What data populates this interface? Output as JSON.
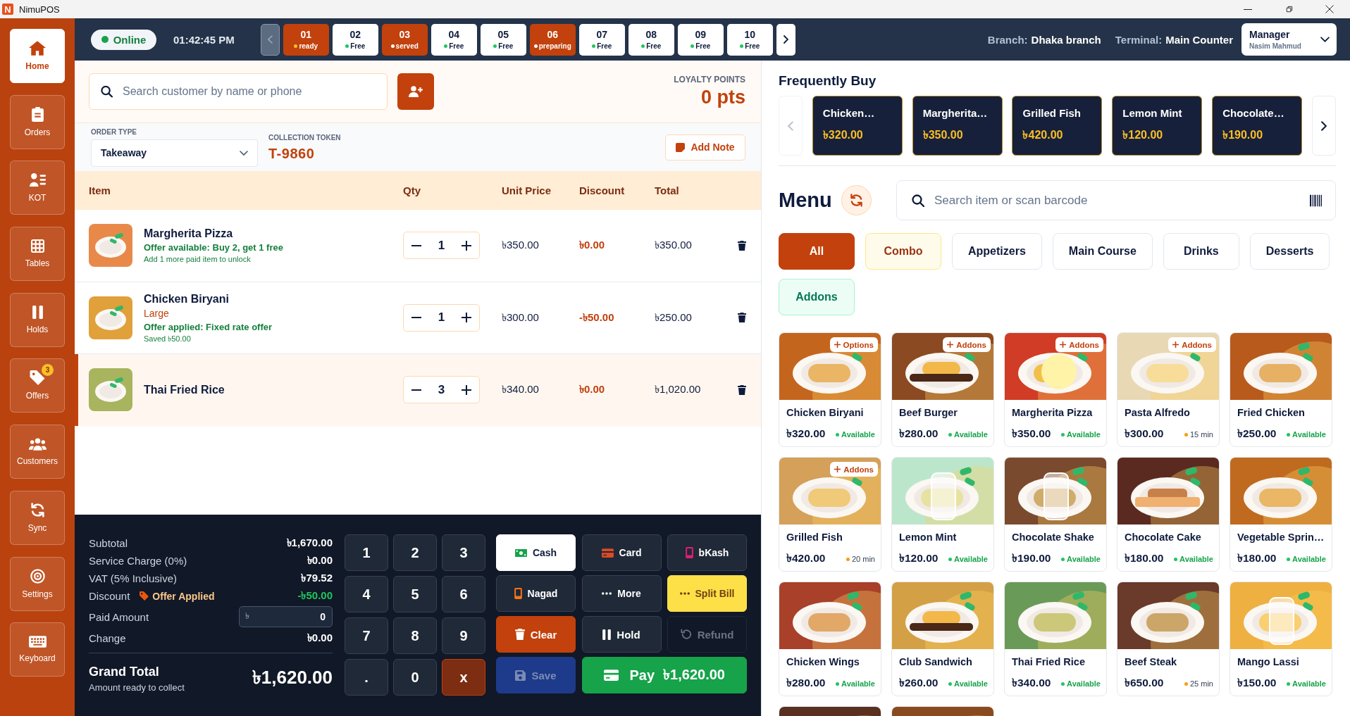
{
  "window": {
    "logo": "N",
    "title": "NimuPOS"
  },
  "sidebar": [
    {
      "label": "Home",
      "selected": true
    },
    {
      "label": "Orders",
      "selected": false
    },
    {
      "label": "KOT",
      "selected": false
    },
    {
      "label": "Tables",
      "selected": false
    },
    {
      "label": "Holds",
      "selected": false
    },
    {
      "label": "Offers",
      "selected": false,
      "badge": "3"
    },
    {
      "label": "Customers",
      "selected": false
    },
    {
      "label": "Sync",
      "selected": false
    },
    {
      "label": "Settings",
      "selected": false
    },
    {
      "label": "Keyboard",
      "selected": false
    }
  ],
  "topbar": {
    "status": "Online",
    "time": "01:42:45 PM",
    "tables_prev": {
      "disabled": true
    },
    "tables": [
      {
        "number": "01",
        "status": "ready",
        "kind": "ready"
      },
      {
        "number": "02",
        "status": "Free",
        "kind": "free"
      },
      {
        "number": "03",
        "status": "served",
        "kind": "served"
      },
      {
        "number": "04",
        "status": "Free",
        "kind": "free"
      },
      {
        "number": "05",
        "status": "Free",
        "kind": "free"
      },
      {
        "number": "06",
        "status": "preparing",
        "kind": "preparing"
      },
      {
        "number": "07",
        "status": "Free",
        "kind": "free"
      },
      {
        "number": "08",
        "status": "Free",
        "kind": "free"
      },
      {
        "number": "09",
        "status": "Free",
        "kind": "free"
      },
      {
        "number": "10",
        "status": "Free",
        "kind": "free"
      }
    ],
    "tables_next": {
      "disabled": false
    },
    "branch": {
      "label": "Branch:",
      "value": "Dhaka branch"
    },
    "terminal": {
      "label": "Terminal:",
      "value": "Main Counter"
    },
    "user": {
      "role": "Manager",
      "name": "Nasim Mahmud"
    }
  },
  "order": {
    "customer_search": {
      "placeholder": "Search customer by name or phone"
    },
    "loyalty": {
      "label": "LOYALTY POINTS",
      "value": "0 pts"
    },
    "order_type": {
      "label": "ORDER TYPE",
      "value": "Takeaway"
    },
    "token": {
      "label": "COLLECTION TOKEN",
      "value": "T-9860"
    },
    "add_note": "Add Note",
    "columns": [
      "Item",
      "Qty",
      "Unit Price",
      "Discount",
      "Total"
    ],
    "items": [
      {
        "name": "Margherita Pizza",
        "notes": [
          {
            "kind": "offer",
            "text": "Offer available: Buy 2, get 1 free"
          },
          {
            "kind": "hint",
            "text": "Add 1 more paid item to unlock"
          }
        ],
        "qty": "1",
        "unit_price": "৳350.00",
        "discount": "৳0.00",
        "total": "৳350.00",
        "selected": false,
        "color": "#e8894a"
      },
      {
        "name": "Chicken Biryani",
        "notes": [
          {
            "kind": "variant",
            "text": "Large"
          },
          {
            "kind": "offer",
            "text": "Offer applied: Fixed rate offer"
          },
          {
            "kind": "hint",
            "text": "Saved ৳50.00"
          }
        ],
        "qty": "1",
        "unit_price": "৳300.00",
        "discount": "-৳50.00",
        "total": "৳250.00",
        "selected": false,
        "color": "#e0a03a"
      },
      {
        "name": "Thai Fried Rice",
        "qty": "3",
        "unit_price": "৳340.00",
        "discount": "৳0.00",
        "total": "৳1,020.00",
        "selected": true,
        "color": "#a8b45e"
      }
    ]
  },
  "summary": {
    "lines": [
      {
        "kind": "plain",
        "label": "Subtotal",
        "value": "৳1,670.00"
      },
      {
        "kind": "plain",
        "label": "Service Charge (0%)",
        "value": "৳0.00"
      },
      {
        "kind": "plain",
        "label": "VAT (5% Inclusive)",
        "value": "৳79.52"
      },
      {
        "kind": "discount",
        "label": "Discount",
        "tag": "Offer Applied",
        "value": "-৳50.00"
      },
      {
        "kind": "input",
        "label": "Paid Amount",
        "prefix": "৳",
        "value": "0"
      },
      {
        "kind": "plain",
        "label": "Change",
        "value": "৳0.00"
      }
    ],
    "grand_total": {
      "label": "Grand Total",
      "note": "Amount ready to collect",
      "value": "৳1,620.00"
    }
  },
  "keypad": [
    {
      "label": "1",
      "kind": "digit"
    },
    {
      "label": "2",
      "kind": "digit"
    },
    {
      "label": "3",
      "kind": "digit"
    },
    {
      "label": "4",
      "kind": "digit"
    },
    {
      "label": "5",
      "kind": "digit"
    },
    {
      "label": "6",
      "kind": "digit"
    },
    {
      "label": "7",
      "kind": "digit"
    },
    {
      "label": "8",
      "kind": "digit"
    },
    {
      "label": "9",
      "kind": "digit"
    },
    {
      "label": ".",
      "kind": "digit"
    },
    {
      "label": "0",
      "kind": "digit"
    },
    {
      "label": "x",
      "kind": "delete"
    }
  ],
  "actions": [
    {
      "label": "Cash",
      "kind": "cash",
      "color": "#16a34a",
      "selected": true,
      "disabled": false
    },
    {
      "label": "Card",
      "kind": "card",
      "color": "#dc4a26",
      "selected": false,
      "disabled": false
    },
    {
      "label": "bKash",
      "kind": "mobile",
      "color": "#e11d74",
      "selected": false,
      "disabled": false
    },
    {
      "label": "Nagad",
      "kind": "mobile",
      "color": "#f97316",
      "selected": false,
      "disabled": false
    },
    {
      "label": "More",
      "kind": "more",
      "selected": false,
      "disabled": false
    },
    {
      "label": "Split Bill",
      "kind": "split",
      "selected": false,
      "disabled": false
    },
    {
      "label": "Clear",
      "kind": "clear",
      "selected": false,
      "disabled": false
    },
    {
      "label": "Hold",
      "kind": "hold",
      "selected": false,
      "disabled": false
    },
    {
      "label": "Refund",
      "kind": "refund",
      "selected": false,
      "disabled": true
    },
    {
      "label": "Save",
      "kind": "save",
      "selected": false,
      "disabled": true
    },
    {
      "label": "Pay",
      "amount": "৳1,620.00",
      "kind": "pay",
      "selected": false,
      "disabled": false
    }
  ],
  "frequently_buy": {
    "title": "Frequently Buy",
    "prev": {
      "disabled": true
    },
    "items": [
      {
        "name": "Chicken…",
        "price": "৳320.00"
      },
      {
        "name": "Margherita…",
        "price": "৳350.00"
      },
      {
        "name": "Grilled Fish",
        "price": "৳420.00"
      },
      {
        "name": "Lemon Mint",
        "price": "৳120.00"
      },
      {
        "name": "Chocolate…",
        "price": "৳190.00"
      }
    ],
    "next": {
      "disabled": false
    }
  },
  "menu": {
    "title": "Menu",
    "search": {
      "placeholder": "Search item or scan barcode"
    },
    "categories": [
      {
        "label": "All",
        "kind": "plain",
        "selected": true
      },
      {
        "label": "Combo",
        "kind": "combo",
        "selected": false
      },
      {
        "label": "Appetizers",
        "kind": "plain",
        "selected": false
      },
      {
        "label": "Main Course",
        "kind": "plain",
        "selected": false
      },
      {
        "label": "Drinks",
        "kind": "plain",
        "selected": false
      },
      {
        "label": "Desserts",
        "kind": "plain",
        "selected": false
      },
      {
        "label": "Addons",
        "kind": "addon",
        "selected": false
      }
    ],
    "products": [
      {
        "name": "Chicken Biryani",
        "price": "৳320.00",
        "status": {
          "kind": "available",
          "text": "Available"
        },
        "badge": "Options",
        "kind": "plate",
        "color": "#c4651e"
      },
      {
        "name": "Beef Burger",
        "price": "৳280.00",
        "status": {
          "kind": "available",
          "text": "Available"
        },
        "badge": "Addons",
        "kind": "burger",
        "color": "#8b4a22"
      },
      {
        "name": "Margherita Pizza",
        "price": "৳350.00",
        "status": {
          "kind": "available",
          "text": "Available"
        },
        "badge": "Addons",
        "kind": "pizza",
        "color": "#d03c25"
      },
      {
        "name": "Pasta Alfredo",
        "price": "৳300.00",
        "status": {
          "kind": "wait",
          "text": "15 min"
        },
        "badge": "Addons",
        "kind": "plate",
        "color": "#e8d8b4"
      },
      {
        "name": "Fried Chicken",
        "price": "৳250.00",
        "status": {
          "kind": "available",
          "text": "Available"
        },
        "kind": "plate",
        "color": "#b85a1c"
      },
      {
        "name": "Grilled Fish",
        "price": "৳420.00",
        "status": {
          "kind": "wait",
          "text": "20 min"
        },
        "badge": "Addons",
        "kind": "plate",
        "color": "#d4a05a"
      },
      {
        "name": "Lemon Mint",
        "price": "৳120.00",
        "status": {
          "kind": "available",
          "text": "Available"
        },
        "kind": "drink",
        "color": "#bce6cc"
      },
      {
        "name": "Chocolate Shake",
        "price": "৳190.00",
        "status": {
          "kind": "available",
          "text": "Available"
        },
        "kind": "drink",
        "color": "#7a4a2e"
      },
      {
        "name": "Chocolate Cake",
        "price": "৳180.00",
        "status": {
          "kind": "available",
          "text": "Available"
        },
        "kind": "cake",
        "color": "#5a2a20"
      },
      {
        "name": "Vegetable Sprin…",
        "price": "৳180.00",
        "status": {
          "kind": "available",
          "text": "Available"
        },
        "kind": "plate",
        "color": "#c06a1f"
      },
      {
        "name": "Chicken Wings",
        "price": "৳280.00",
        "status": {
          "kind": "available",
          "text": "Available"
        },
        "kind": "plate",
        "color": "#a8402a"
      },
      {
        "name": "Club Sandwich",
        "price": "৳260.00",
        "status": {
          "kind": "available",
          "text": "Available"
        },
        "kind": "burger",
        "color": "#d4a045"
      },
      {
        "name": "Thai Fried Rice",
        "price": "৳340.00",
        "status": {
          "kind": "available",
          "text": "Available"
        },
        "kind": "plate",
        "color": "#6a9a58"
      },
      {
        "name": "Beef Steak",
        "price": "৳650.00",
        "status": {
          "kind": "wait",
          "text": "25 min"
        },
        "kind": "plate",
        "color": "#6a3a2a"
      },
      {
        "name": "Mango Lassi",
        "price": "৳150.00",
        "status": {
          "kind": "available",
          "text": "Available"
        },
        "kind": "drink",
        "color": "#eeb040"
      },
      {
        "kind": "plate",
        "color": "#5a3020"
      },
      {
        "kind": "plate",
        "color": "#8a4a20"
      }
    ]
  }
}
